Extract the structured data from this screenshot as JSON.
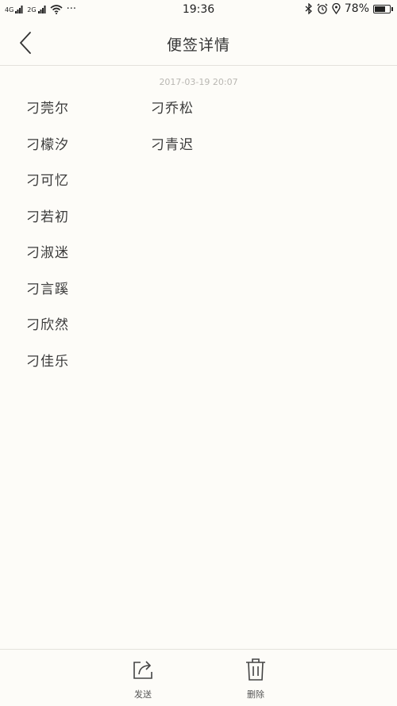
{
  "status_bar": {
    "net1": "4G",
    "net2": "2G",
    "dots": "···",
    "time": "19:36",
    "battery_pct": "78%",
    "battery_level": 0.78,
    "icons": [
      "bluetooth-icon",
      "alarm-icon",
      "location-icon",
      "battery-icon"
    ]
  },
  "header": {
    "title": "便签详情",
    "back_icon": "chevron-left-icon"
  },
  "note": {
    "timestamp": "2017-03-19 20:07",
    "column1": [
      "刁莞尔",
      "刁檬汐",
      "刁可忆",
      "刁若初",
      "刁淑迷",
      "刁言蹊",
      "刁欣然",
      "刁佳乐"
    ],
    "column2": [
      "刁乔松",
      "刁青迟"
    ]
  },
  "toolbar": {
    "send_label": "发送",
    "send_icon": "share-icon",
    "delete_label": "删除",
    "delete_icon": "trash-icon"
  },
  "colors": {
    "background": "#fdfcf8",
    "text": "#333333",
    "timestamp": "#b9b7b2",
    "divider": "#e4e2dc"
  }
}
